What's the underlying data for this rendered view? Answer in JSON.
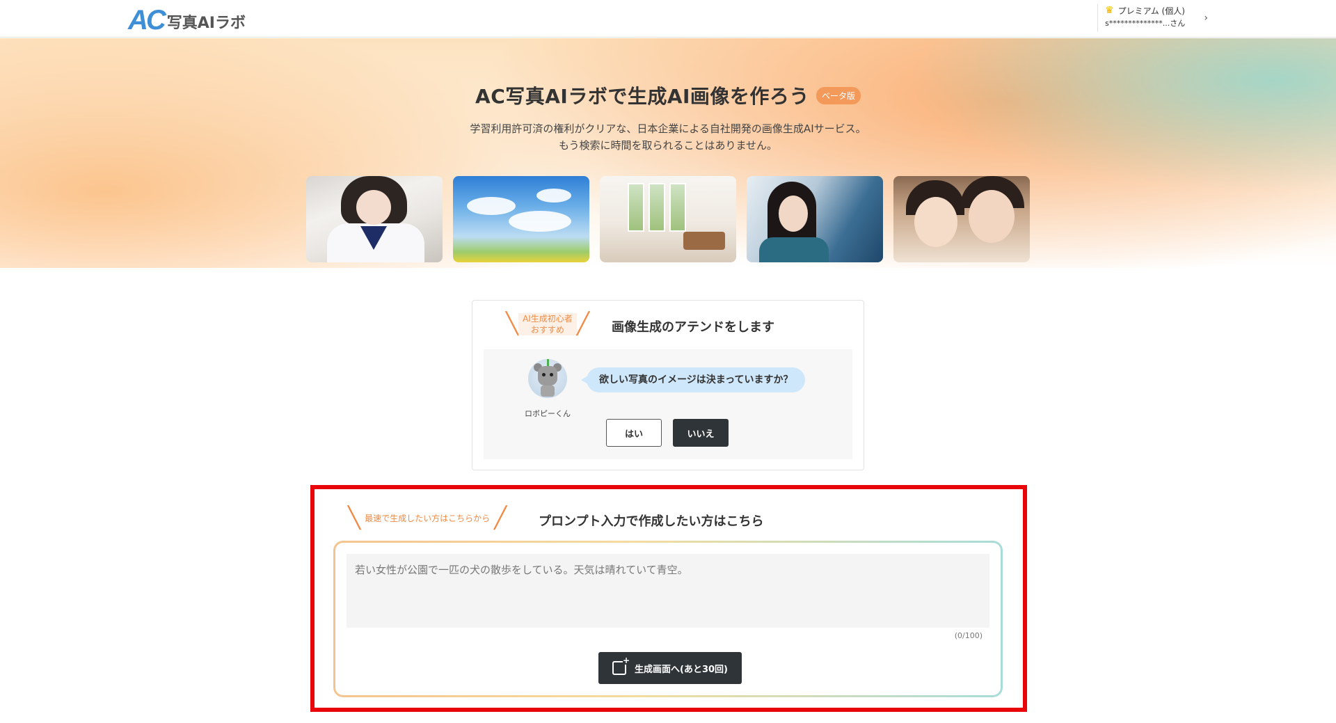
{
  "header": {
    "logo_mark": "AC",
    "logo_text": "写真AIラボ",
    "plan_label": "プレミアム (個人)",
    "user_label": "s**************...さん"
  },
  "hero": {
    "title": "AC写真AIラボで生成AI画像を作ろう",
    "beta_badge": "ベータ版",
    "subtitle_line1": "学習利用許可済の権利がクリアな、日本企業による自社開発の画像生成AIサービス。",
    "subtitle_line2": "もう検索に時間を取られることはありません。",
    "photos": [
      "photo-student",
      "photo-sky",
      "photo-interior",
      "photo-woman",
      "photo-children"
    ]
  },
  "attend": {
    "tag_line1": "AI生成初心者",
    "tag_line2": "おすすめ",
    "title": "画像生成のアテンドをします",
    "robot_name": "ロボピーくん",
    "question": "欲しい写真のイメージは決まっていますか？",
    "yes_label": "はい",
    "no_label": "いいえ"
  },
  "prompt": {
    "tag": "最速で生成したい方はこちらから",
    "title": "プロンプト入力で作成したい方はこちら",
    "placeholder": "若い女性が公園で一匹の犬の散歩をしている。天気は晴れていて青空。",
    "value": "",
    "char_count": "(0/100)",
    "generate_label": "生成画面へ(あと30回)"
  },
  "colors": {
    "accent_orange": "#f08a44",
    "dark_button": "#2f3438",
    "highlight_red": "#e8060a",
    "logo_blue": "#3f8fd6"
  }
}
